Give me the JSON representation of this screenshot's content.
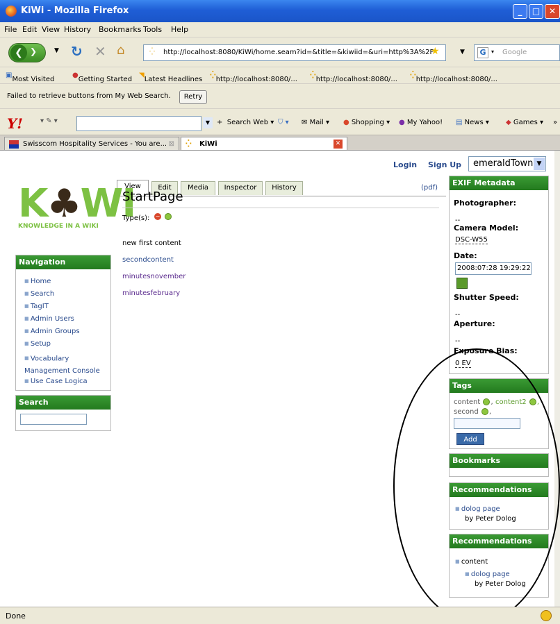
{
  "window": {
    "title": "KiWi - Mozilla Firefox"
  },
  "menu": [
    "File",
    "Edit",
    "View",
    "History",
    "Bookmarks",
    "Tools",
    "Help"
  ],
  "nav": {
    "url": "http://localhost:8080/KiWi/home.seam?id=&title=&kiwiid=&uri=http%3A%2F",
    "search_placeholder": "Google"
  },
  "bookmarks": [
    "Most Visited",
    "Getting Started",
    "Latest Headlines",
    "http://localhost:8080/...",
    "http://localhost:8080/...",
    "http://localhost:8080/..."
  ],
  "notification": {
    "text": "Failed to retrieve buttons from My Web Search.",
    "button": "Retry"
  },
  "yahoo": {
    "items": [
      "Search Web",
      "Mail",
      "Shopping",
      "My Yahoo!",
      "News",
      "Games"
    ]
  },
  "tabs": [
    {
      "label": "Swisscom Hospitality Services - You are..."
    },
    {
      "label": "KiWi"
    }
  ],
  "header": {
    "login": "Login",
    "signup": "Sign Up",
    "space": "emeraldTown"
  },
  "pagetabs": [
    "View",
    "Edit",
    "Media",
    "Inspector",
    "History"
  ],
  "logo": {
    "tagline": "KNOWLEDGE IN A WIKI"
  },
  "navigation": {
    "title": "Navigation",
    "items": [
      "Home",
      "Search",
      "TagIT",
      "Admin Users",
      "Admin Groups",
      "Setup",
      "Vocabulary Management Console",
      "Use Case Logica"
    ]
  },
  "search": {
    "title": "Search"
  },
  "page": {
    "pdf": "(pdf)",
    "title": "StartPage",
    "types_label": "Type(s):",
    "content": [
      "new first content",
      "secondcontent",
      "minutesnovember",
      "minutesfebruary"
    ]
  },
  "exif": {
    "title": "EXIF Metadata",
    "photographer_label": "Photographer:",
    "photographer": "--",
    "camera_label": "Camera Model:",
    "camera": "DSC-W55",
    "date_label": "Date:",
    "date": "2008:07:28 19:29:22",
    "shutter_label": "Shutter Speed:",
    "shutter": "--",
    "aperture_label": "Aperture:",
    "aperture": "--",
    "bias_label": "Exposure Bias:",
    "bias": "0 EV"
  },
  "tags": {
    "title": "Tags",
    "items": [
      "content",
      "content2",
      "second"
    ],
    "add": "Add"
  },
  "bookmarks_box": {
    "title": "Bookmarks"
  },
  "recommendations1": {
    "title": "Recommendations",
    "link": "dolog page",
    "by": "by Peter Dolog"
  },
  "recommendations2": {
    "title": "Recommendations",
    "group": "content",
    "link": "dolog page",
    "by": "by Peter Dolog"
  },
  "status": {
    "text": "Done"
  }
}
